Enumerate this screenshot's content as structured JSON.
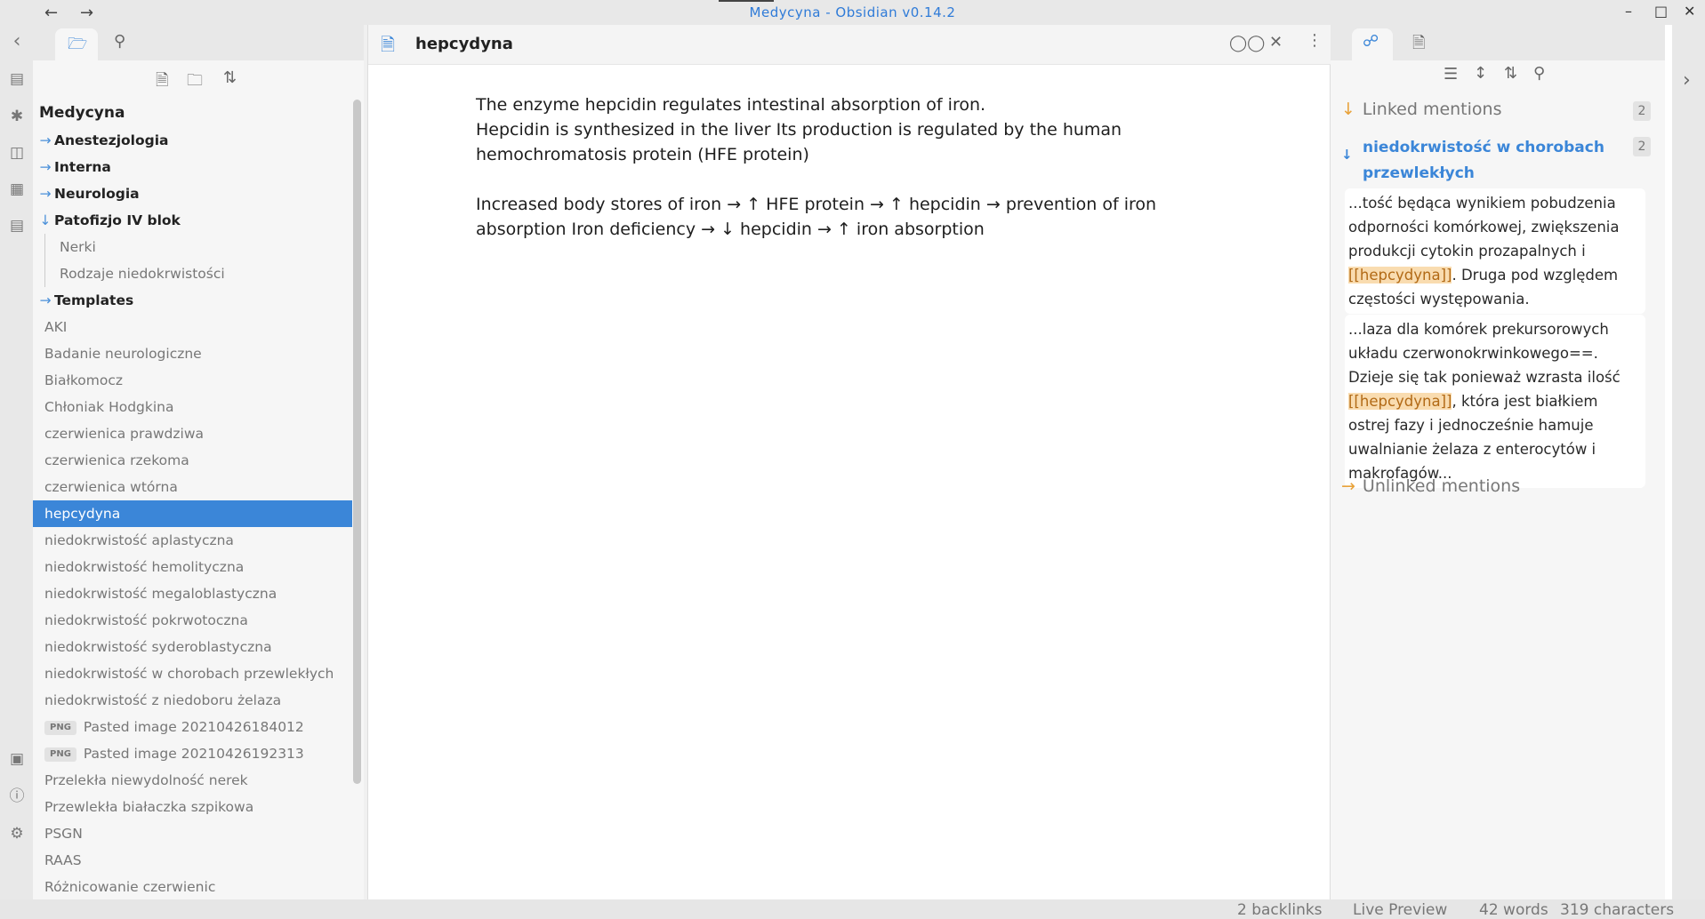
{
  "window": {
    "title": "Medycyna - Obsidian v0.14.2",
    "back_icon": "arrow-left-icon",
    "forward_icon": "arrow-right-icon"
  },
  "ribbon": {
    "icons": [
      "collapse-left-icon",
      "open-quick-switcher-icon",
      "graph-view-icon",
      "slides-icon",
      "calendar-icon",
      "templates-icon",
      "vault-icon",
      "help-icon",
      "settings-icon"
    ]
  },
  "file_explorer": {
    "tab_icons": [
      "folder-icon",
      "search-icon"
    ],
    "toolbar_icons": [
      "new-note-icon",
      "new-folder-icon",
      "sort-icon"
    ],
    "vault_name": "Medycyna",
    "folders": [
      {
        "label": "Anestezjologia",
        "expanded": false
      },
      {
        "label": "Interna",
        "expanded": false
      },
      {
        "label": "Neurologia",
        "expanded": false
      },
      {
        "label": "Patofizjo IV blok",
        "expanded": true
      }
    ],
    "subfiles": [
      "Nerki",
      "Rodzaje niedokrwistości"
    ],
    "templates_folder": "Templates",
    "files": [
      "AKI",
      "Badanie neurologiczne",
      "Białkomocz",
      "Chłoniak Hodgkina",
      "czerwienica prawdziwa",
      "czerwienica rzekoma",
      "czerwienica wtórna",
      "hepcydyna",
      "niedokrwistość aplastyczna",
      "niedokrwistość hemolityczna",
      "niedokrwistość megaloblastyczna",
      "niedokrwistość pokrwotoczna",
      "niedokrwistość syderoblastyczna",
      "niedokrwistość w chorobach przewlekłych",
      "niedokrwistość z niedoboru żelaza"
    ],
    "png_badge": "PNG",
    "png_files": [
      "Pasted image 20210426184012",
      "Pasted image 20210426192313"
    ],
    "files_after": [
      "Przelekła niewydolność nerek",
      "Przewlekła białaczka szpikowa",
      "PSGN",
      "RAAS",
      "Różnicowanie czerwienic"
    ],
    "active_file": "hepcydyna"
  },
  "editor": {
    "title": "hepcydyna",
    "header_icons": [
      "reading-mode-icon",
      "close-icon",
      "more-options-icon"
    ],
    "paragraphs": [
      "The enzyme hepcidin regulates intestinal absorption of iron.\nHepcidin is synthesized in the liver Its production is regulated by the human hemochromatosis protein (HFE protein)",
      "Increased body stores of iron → ↑ HFE protein → ↑ hepcidin → prevention of iron absorption Iron deficiency → ↓ hepcidin → ↑ iron absorption"
    ]
  },
  "backlinks": {
    "tab_icons": [
      "backlinks-icon",
      "outgoing-links-icon"
    ],
    "toolbar_icons": [
      "collapse-results-icon",
      "show-more-context-icon",
      "sort-icon",
      "search-icon"
    ],
    "linked_label": "Linked mentions",
    "linked_count": "2",
    "file_name": "niedokrwistość w chorobach przewlekłych",
    "file_count": "2",
    "snippet1_before": "...tość będąca wynikiem pobudzenia odporności komórkowej, zwiększenia produkcji cytokin prozapalnych i ",
    "snippet1_link": "[[hepcydyna]]",
    "snippet1_after": ". Druga pod względem częstości występowania.",
    "snippet2_before": "...laza dla komórek prekursorowych układu czerwonokrwinkowego==. Dzieje się tak ponieważ wzrasta ilość ",
    "snippet2_link": "[[hepcydyna]]",
    "snippet2_after": ", która jest białkiem ostrej fazy i jednocześnie hamuje uwalnianie żelaza z enterocytów i makrofagów...",
    "unlinked_label": "Unlinked mentions"
  },
  "statusbar": {
    "backlinks": "2 backlinks",
    "mode": "Live Preview",
    "words": "42 words",
    "characters": "319 characters"
  }
}
